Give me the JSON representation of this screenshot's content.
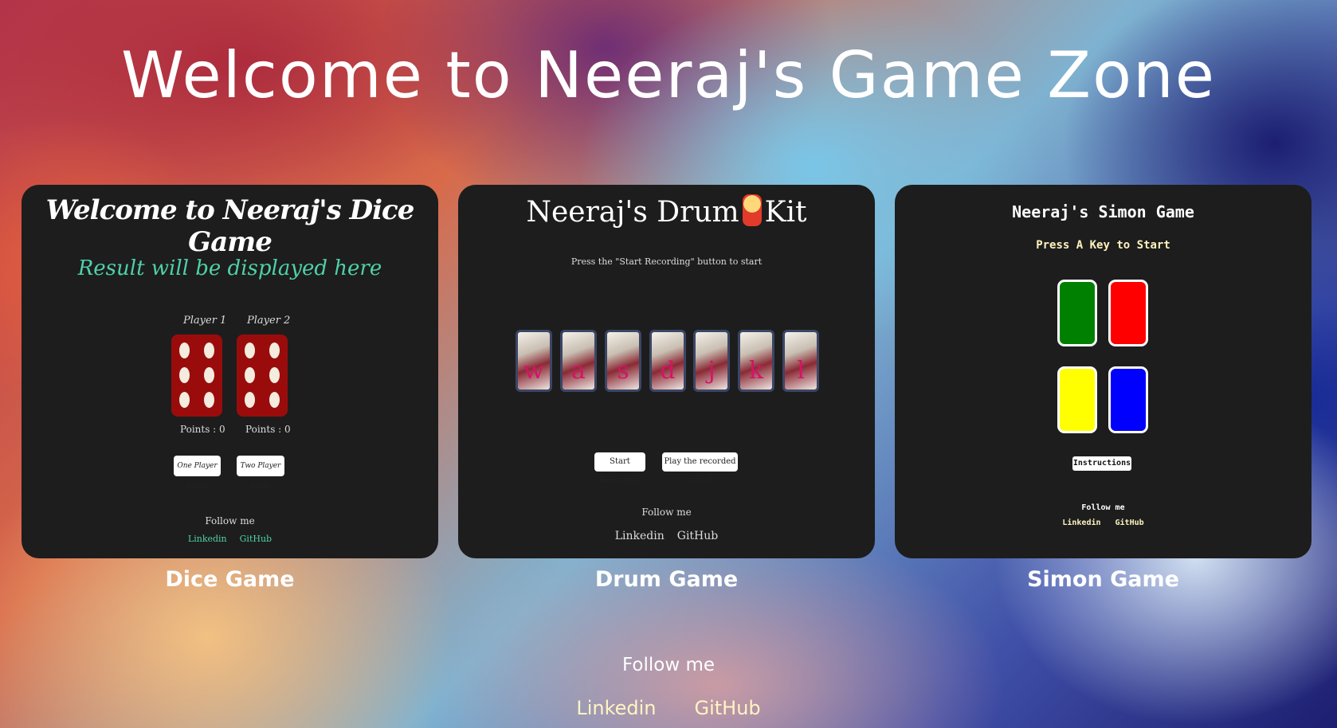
{
  "page": {
    "title": "Welcome to Neeraj's Game Zone"
  },
  "cards": {
    "dice": {
      "label": "Dice Game",
      "title": "Welcome to Neeraj's Dice Game",
      "result": "Result will be displayed here",
      "player1": "Player 1",
      "player2": "Player 2",
      "points1": "Points : 0",
      "points2": "Points : 0",
      "btn_one": "One Player Mode",
      "btn_two": "Two Player Mode",
      "follow": "Follow me",
      "linkedin": "Linkedin",
      "github": "GitHub",
      "die_face_1": 6,
      "die_face_2": 6,
      "accent": "#4fd0a8",
      "die_color": "#9a0c0c"
    },
    "drum": {
      "label": "Drum Game",
      "title_left": "Neeraj's Drum",
      "title_right": "Kit",
      "title_icon": "drum-emoji-icon",
      "instruction": "Press the \"Start Recording\" button to start",
      "keys": [
        "w",
        "a",
        "s",
        "d",
        "j",
        "k",
        "l"
      ],
      "btn_record": "Start Recording",
      "btn_play": "Play the recorded sound",
      "follow": "Follow me",
      "linkedin": "Linkedin",
      "github": "GitHub",
      "key_color": "#d41466"
    },
    "simon": {
      "label": "Simon Game",
      "title": "Neeraj's Simon Game",
      "subtitle": "Press A Key to Start",
      "instructions": "Instructions",
      "follow": "Follow me",
      "linkedin": "Linkedin",
      "github": "GitHub",
      "colors": {
        "green": "#008000",
        "red": "#ff0000",
        "yellow": "#ffff00",
        "blue": "#0000ff"
      }
    }
  },
  "footer": {
    "follow": "Follow me",
    "linkedin": "Linkedin",
    "github": "GitHub"
  }
}
